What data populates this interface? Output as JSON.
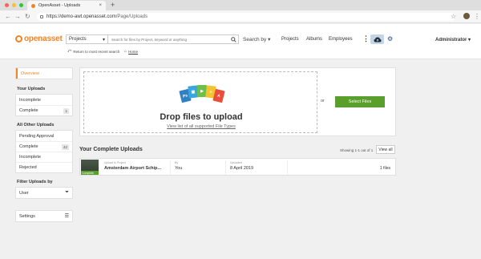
{
  "browser": {
    "tab_title": "OpenAsset - Uploads",
    "url_host": "https://demo-awt.openasset.com",
    "url_path": "/Page/Uploads"
  },
  "header": {
    "logo_text": "openasset",
    "search_scope": "Projects",
    "search_placeholder": "Search for files by Project, keyword or anything",
    "search_by": "Search by",
    "nav": [
      "Projects",
      "Albums",
      "Employees"
    ],
    "user": "Administrator",
    "return_link": "Return to most recent search",
    "home_link": "Home"
  },
  "sidebar": {
    "overview": "Overview",
    "your_uploads_heading": "Your Uploads",
    "your_uploads": [
      {
        "label": "Incomplete",
        "count": ""
      },
      {
        "label": "Complete",
        "count": "1"
      }
    ],
    "other_uploads_heading": "All Other Uploads",
    "other_uploads": [
      {
        "label": "Pending Approval",
        "count": ""
      },
      {
        "label": "Complete",
        "count": "42"
      },
      {
        "label": "Incomplete",
        "count": ""
      },
      {
        "label": "Rejected",
        "count": ""
      }
    ],
    "filter_heading": "Filter Uploads by",
    "filter_value": "User",
    "settings": "Settings"
  },
  "dropzone": {
    "title": "Drop files to upload",
    "link": "View list of all supported File Types",
    "or": "or",
    "select_button": "Select Files",
    "file_icon_colors": [
      "#2f80c5",
      "#39a6e0",
      "#6cc04a",
      "#f4c430",
      "#e94e3c"
    ]
  },
  "complete_uploads": {
    "title": "Your Complete Uploads",
    "showing": "Showing 1-1 out of 1",
    "view_all": "View all",
    "rows": [
      {
        "thumb_tag": "Complete",
        "project_label": "Upload to Project",
        "project": "Amsterdam Airport Schip...",
        "by_label": "By",
        "by": "You",
        "uploaded_label": "Uploaded",
        "uploaded": "8 April 2019",
        "files": "1 files"
      }
    ]
  }
}
